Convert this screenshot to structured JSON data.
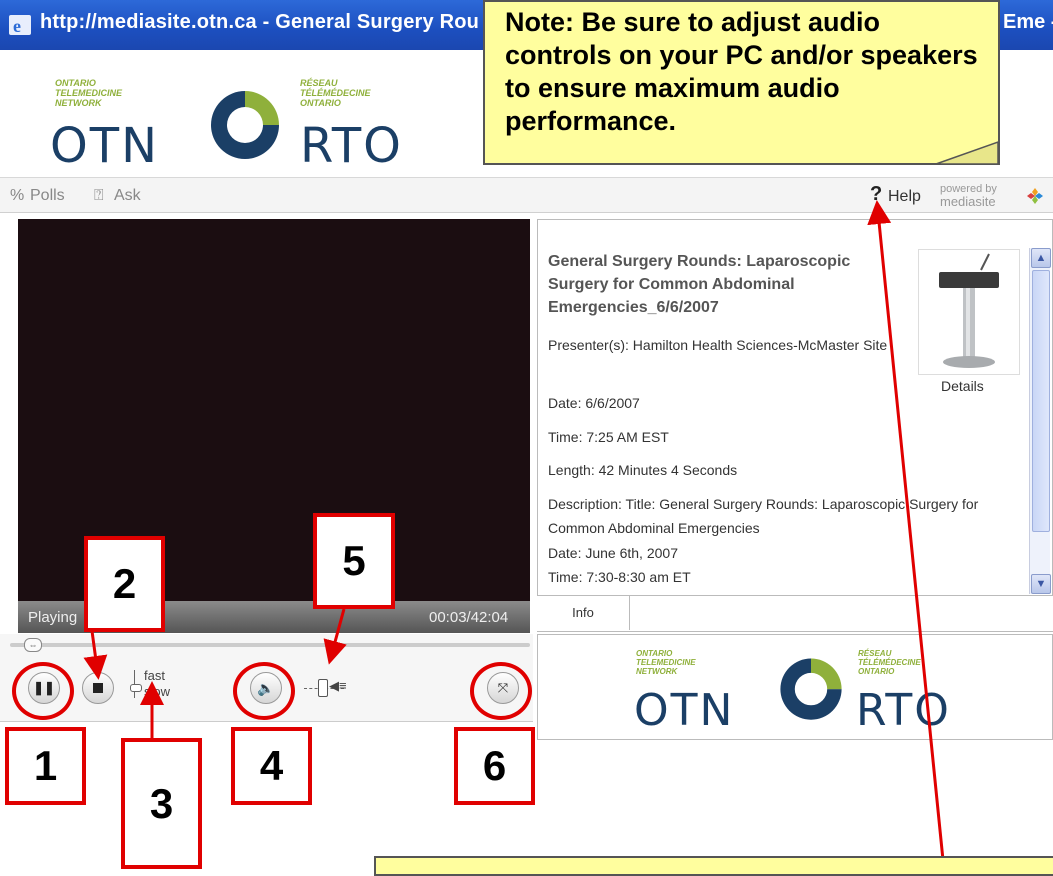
{
  "window": {
    "title": "http://mediasite.otn.ca - General Surgery Rou",
    "title_right": "Eme -"
  },
  "logo": {
    "left_small": "ONTARIO TELEMEDICINE NETWORK",
    "left_word": "OTN",
    "right_small": "RÉSEAU TÉLÉMÉDECINE ONTARIO",
    "right_word": "RTO"
  },
  "menu": {
    "polls": "Polls",
    "ask": "Ask",
    "help": "Help",
    "powered_by": "powered by",
    "mediasite": "mediasite"
  },
  "player": {
    "status": "Playing",
    "time": "00:03/42:04",
    "speed_fast": "fast",
    "speed_slow": "slow"
  },
  "info": {
    "title": "General Surgery Rounds: Laparoscopic Surgery for Common Abdominal Emergencies_6/6/2007",
    "presenter": "Presenter(s): Hamilton Health Sciences-McMaster Site",
    "date": "Date: 6/6/2007",
    "time": "Time: 7:25 AM EST",
    "length": "Length: 42 Minutes 4 Seconds",
    "description": "Description: Title: General Surgery Rounds: Laparoscopic Surgery for Common Abdominal Emergencies",
    "desc_date": "Date: June 6th, 2007",
    "desc_time": "Time: 7:30-8:30 am ET",
    "details": "Details",
    "tab": "Info"
  },
  "note": {
    "text": "Note: Be sure to adjust audio controls on your PC and/or speakers to ensure maximum audio performance."
  },
  "callouts": [
    "1",
    "2",
    "3",
    "4",
    "5",
    "6"
  ],
  "colors": {
    "callout_red": "#e00000",
    "note_yellow": "#fffe9e",
    "otn_blue": "#1b3f66",
    "otn_green": "#8fb03b"
  }
}
